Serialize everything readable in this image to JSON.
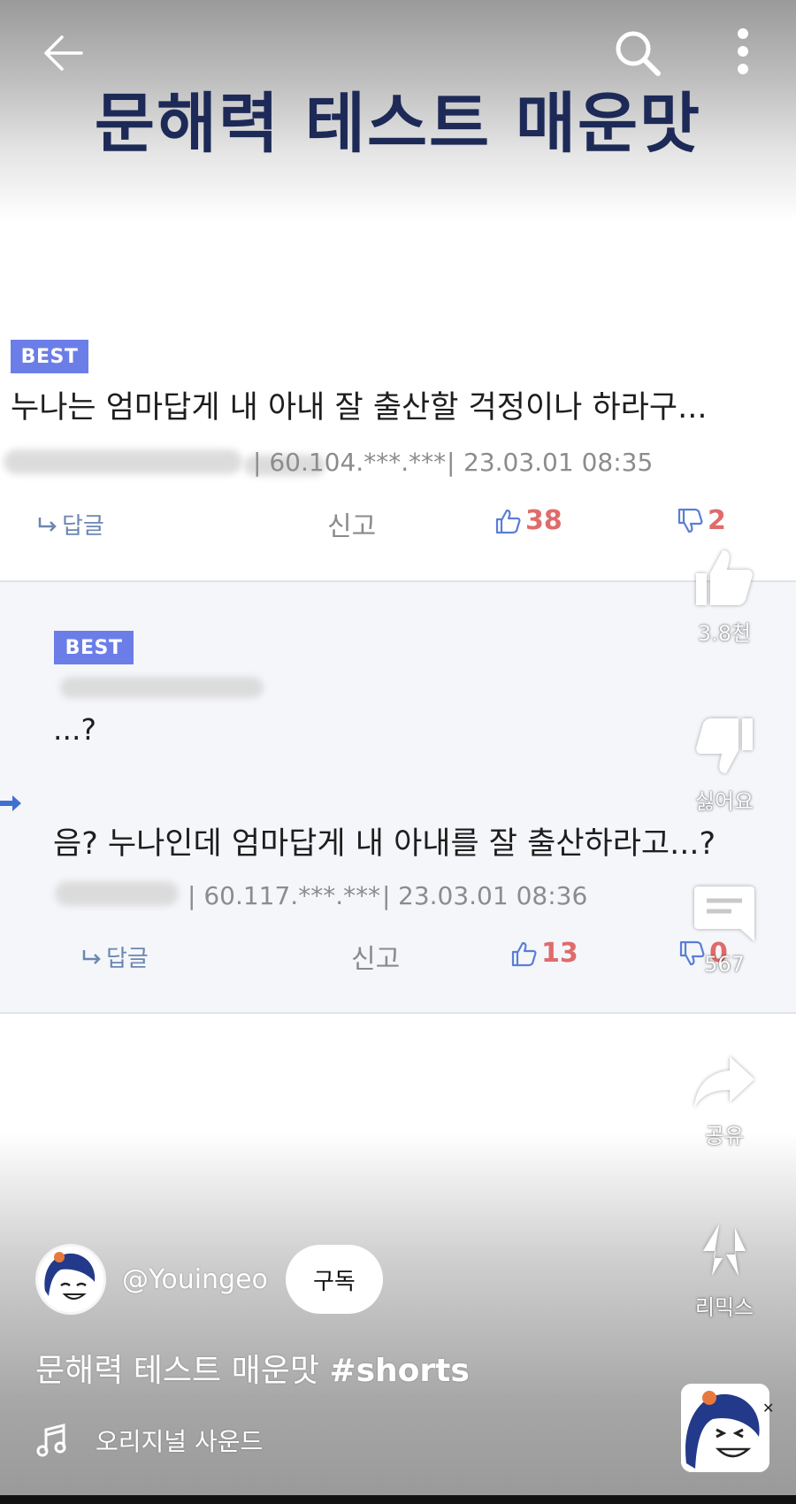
{
  "header": {
    "title": "문해력 테스트 매운맛",
    "back_icon": "arrow-left-icon",
    "search_icon": "search-icon",
    "more_icon": "more-vertical-icon"
  },
  "comment1": {
    "badge": "BEST",
    "text": "누나는 엄마답게 내 아내 잘 출산할 걱정이나 하라구...",
    "ip": "| 60.104.***.***",
    "date": "23.03.01 08:35",
    "reply_label": "답글",
    "report_label": "신고",
    "likes": "38",
    "dislikes": "2"
  },
  "comment2": {
    "badge": "BEST",
    "line1": "...?",
    "line2": "음? 누나인데 엄마답게 내 아내를 잘 출산하라고...?",
    "ip": "| 60.117.***.***",
    "date": "23.03.01 08:36",
    "reply_label": "답글",
    "report_label": "신고",
    "likes": "13",
    "dislikes": "0"
  },
  "sidebar": {
    "like_count": "3.8천",
    "dislike_label": "싫어요",
    "comment_count": "567",
    "share_label": "공유",
    "remix_label": "리믹스"
  },
  "channel": {
    "handle": "@Youingeo",
    "subscribe_label": "구독"
  },
  "video": {
    "title": "문해력 테스트 매운맛",
    "hashtag": "#shorts",
    "sound_label": "오리지널 사운드"
  },
  "colors": {
    "title": "#1d2a57",
    "badge": "#6b7ee8",
    "vote_count": "#e06b6b",
    "reply_link": "#6d86b0",
    "reply_bg": "#f4f6fa"
  }
}
